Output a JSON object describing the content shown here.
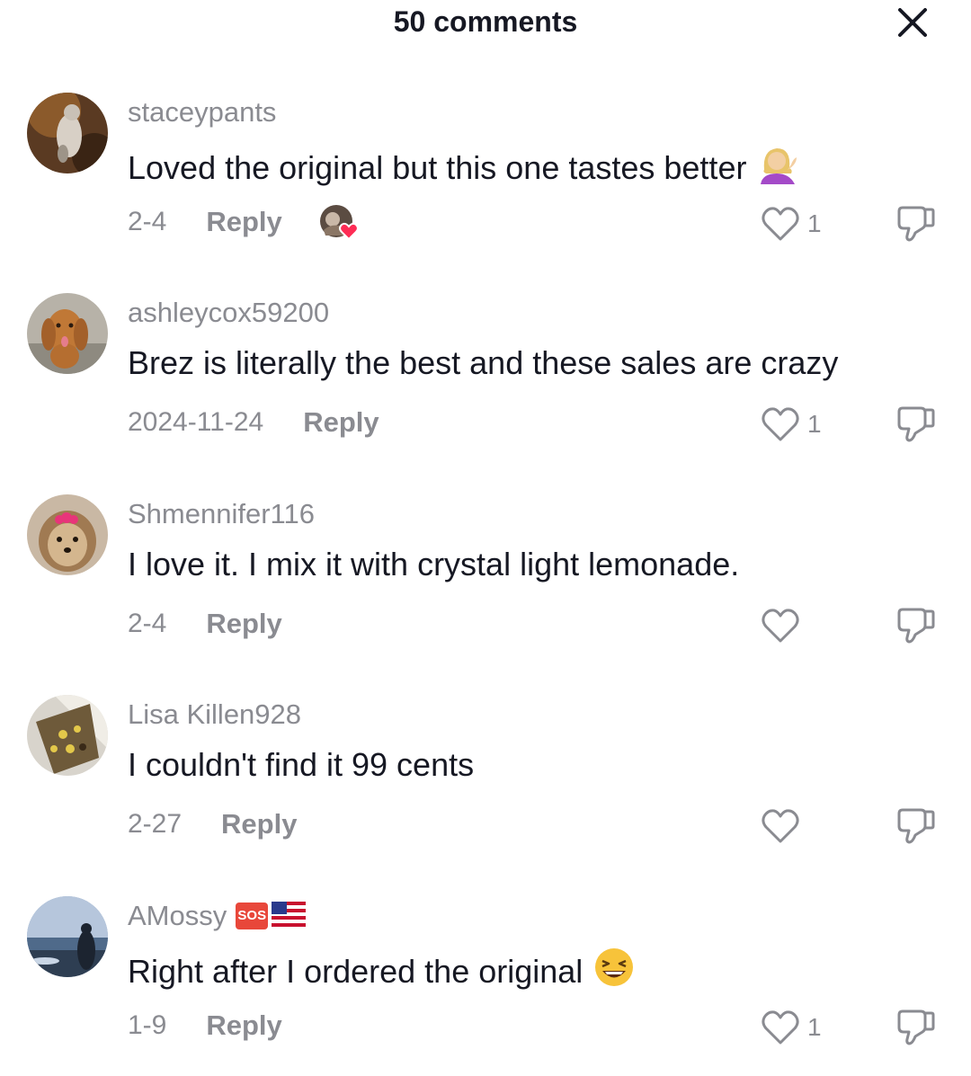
{
  "header": {
    "title": "50 comments",
    "close_icon": "close-icon"
  },
  "comments": [
    {
      "username": "staceypants",
      "text": "Loved the original but this one tastes better",
      "emoji": "💁🏼‍♀️",
      "date": "2-4",
      "reply_label": "Reply",
      "likes": "1",
      "creator_liked": true
    },
    {
      "username": "ashleycox59200",
      "text": "Brez is literally the best and these sales are crazy",
      "emoji": "",
      "date": "2024-11-24",
      "reply_label": "Reply",
      "likes": "1",
      "creator_liked": false
    },
    {
      "username": "Shmennifer116",
      "text": "I love it. I mix it with crystal light lemonade.",
      "emoji": "",
      "date": "2-4",
      "reply_label": "Reply",
      "likes": "",
      "creator_liked": false
    },
    {
      "username": "Lisa Killen928",
      "text": "I couldn't find it 99 cents",
      "emoji": "",
      "date": "2-27",
      "reply_label": "Reply",
      "likes": "",
      "creator_liked": false
    },
    {
      "username": "AMossy",
      "username_badges": [
        "🆘",
        "🇺🇸"
      ],
      "text": "Right after I ordered the original",
      "emoji": "😆",
      "date": "1-9",
      "reply_label": "Reply",
      "likes": "1",
      "creator_liked": false
    }
  ],
  "colors": {
    "text_primary": "#161823",
    "text_secondary": "#8a8b91",
    "heart_badge": "#fe2c55"
  }
}
